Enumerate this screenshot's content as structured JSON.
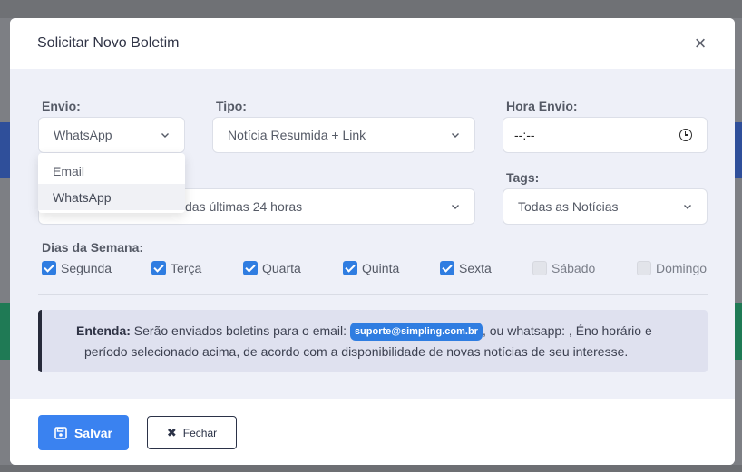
{
  "modal": {
    "title": "Solicitar Novo Boletim",
    "close_icon": "close-icon"
  },
  "form": {
    "envio": {
      "label": "Envio:",
      "value": "WhatsApp",
      "options": [
        "Email",
        "WhatsApp"
      ],
      "selected_option": "WhatsApp"
    },
    "tipo": {
      "label": "Tipo:",
      "value": "Notícia Resumida + Link"
    },
    "hora_envio": {
      "label": "Hora Envio:",
      "value": "--:--"
    },
    "periodo": {
      "value": "das últimas 24 horas"
    },
    "tags": {
      "label": "Tags:",
      "value": "Todas as Notícias"
    },
    "dias": {
      "label": "Dias da Semana:",
      "items": [
        {
          "label": "Segunda",
          "checked": true
        },
        {
          "label": "Terça",
          "checked": true
        },
        {
          "label": "Quarta",
          "checked": true
        },
        {
          "label": "Quinta",
          "checked": true
        },
        {
          "label": "Sexta",
          "checked": true
        },
        {
          "label": "Sábado",
          "checked": false
        },
        {
          "label": "Domingo",
          "checked": false
        }
      ]
    }
  },
  "info": {
    "title": "Entenda:",
    "text_before_email": " Serão enviados boletins para o email: ",
    "email": "suporte@simpling.com.br",
    "text_after_email": ", ou whatsapp: , Éno horário e",
    "line2": "período selecionado acima, de acordo com a disponibilidade de novas notícias de seu interesse."
  },
  "footer": {
    "save_label": "Salvar",
    "close_label": "Fechar"
  },
  "colors": {
    "primary": "#3a82f0",
    "checkbox": "#2f7de1",
    "body_bg": "#eef0f8",
    "info_bg": "#dfe1ef"
  }
}
